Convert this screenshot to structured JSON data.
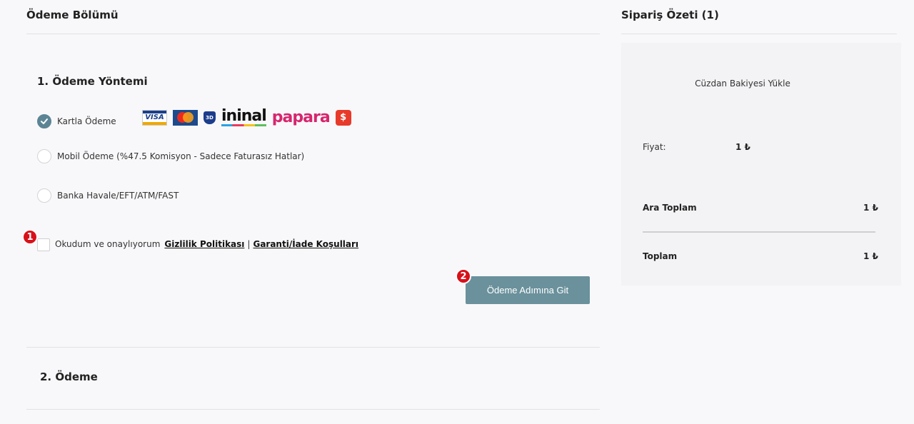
{
  "payment": {
    "section_title": "Ödeme Bölümü",
    "step1_title": "1.  Ödeme Yöntemi",
    "methods": [
      {
        "label": "Kartla Ödeme",
        "selected": true
      },
      {
        "label": "Mobil Ödeme (%47.5 Komisyon - Sadece Faturasız Hatlar)",
        "selected": false
      },
      {
        "label": "Banka Havale/EFT/ATM/FAST",
        "selected": false
      }
    ],
    "logos": {
      "visa": "VISA",
      "mastercard": "MasterCard",
      "secure3d": "3D",
      "ininal": "ininal",
      "papara": "papara",
      "red_icon": "$"
    },
    "consent_text": "Okudum ve onaylıyorum",
    "privacy_link": "Gizlilik Politikası",
    "separator": "|",
    "warranty_link": "Garanti/İade Koşulları",
    "submit_label": "Ödeme Adımına Git",
    "step2_title": "2.  Ödeme"
  },
  "markers": {
    "first": "1",
    "second": "2"
  },
  "summary": {
    "title": "Sipariş Özeti (1)",
    "item_name": "Cüzdan Bakiyesi Yükle",
    "price_label": "Fiyat:",
    "price_value": "1 ₺",
    "subtotal_label": "Ara Toplam",
    "subtotal_value": "1 ₺",
    "total_label": "Toplam",
    "total_value": "1 ₺"
  },
  "colors": {
    "accent": "#5b8595",
    "button": "#6a919c",
    "marker": "#d8101a",
    "background": "#f8f8fa"
  }
}
